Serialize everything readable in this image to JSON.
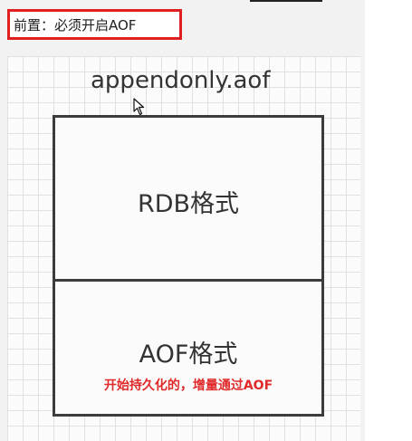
{
  "prerequisite": {
    "text": "前置：必须开启AOF"
  },
  "diagram": {
    "file_name": "appendonly.aof",
    "sections": {
      "rdb": {
        "label": "RDB格式"
      },
      "aof": {
        "label": "AOF格式",
        "note": "开始持久化的，增量通过AOF"
      }
    }
  },
  "colors": {
    "highlight_red": "#e02020",
    "box_border": "#3c3c3c",
    "grid_line": "#e1e1e1"
  },
  "icons": {
    "cursor": "mouse-pointer-icon"
  }
}
